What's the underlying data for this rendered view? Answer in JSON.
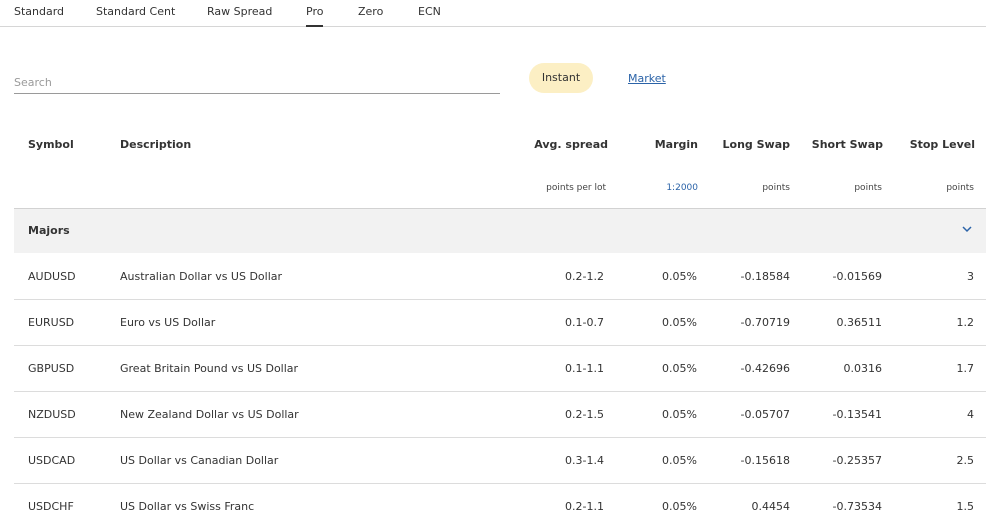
{
  "tabs": [
    {
      "label": "Standard"
    },
    {
      "label": "Standard Cent"
    },
    {
      "label": "Raw Spread"
    },
    {
      "label": "Pro",
      "active": true
    },
    {
      "label": "Zero"
    },
    {
      "label": "ECN"
    }
  ],
  "search": {
    "placeholder": "Search",
    "value": ""
  },
  "execution": {
    "instant": "Instant",
    "market": "Market",
    "selected": "Instant",
    "selected_color": "#fcefc4",
    "link_color": "#2b63a8"
  },
  "table": {
    "columns": {
      "symbol": "Symbol",
      "description": "Description",
      "spread": "Avg. spread",
      "margin": "Margin",
      "long_swap": "Long Swap",
      "short_swap": "Short Swap",
      "stop_level": "Stop Level"
    },
    "units": {
      "spread": "points per lot",
      "margin": "1:2000",
      "long_swap": "points",
      "short_swap": "points",
      "stop_level": "points"
    },
    "group": {
      "label": "Majors",
      "icon": "chevron-down-icon"
    },
    "rows": [
      {
        "symbol": "AUDUSD",
        "description": "Australian Dollar vs US Dollar",
        "spread": "0.2-1.2",
        "margin": "0.05%",
        "long_swap": "-0.18584",
        "short_swap": "-0.01569",
        "stop_level": "3"
      },
      {
        "symbol": "EURUSD",
        "description": "Euro vs US Dollar",
        "spread": "0.1-0.7",
        "margin": "0.05%",
        "long_swap": "-0.70719",
        "short_swap": "0.36511",
        "stop_level": "1.2"
      },
      {
        "symbol": "GBPUSD",
        "description": "Great Britain Pound vs US Dollar",
        "spread": "0.1-1.1",
        "margin": "0.05%",
        "long_swap": "-0.42696",
        "short_swap": "0.0316",
        "stop_level": "1.7"
      },
      {
        "symbol": "NZDUSD",
        "description": "New Zealand Dollar vs US Dollar",
        "spread": "0.2-1.5",
        "margin": "0.05%",
        "long_swap": "-0.05707",
        "short_swap": "-0.13541",
        "stop_level": "4"
      },
      {
        "symbol": "USDCAD",
        "description": "US Dollar vs Canadian Dollar",
        "spread": "0.3-1.4",
        "margin": "0.05%",
        "long_swap": "-0.15618",
        "short_swap": "-0.25357",
        "stop_level": "2.5"
      },
      {
        "symbol": "USDCHF",
        "description": "US Dollar vs Swiss Franc",
        "spread": "0.2-1.1",
        "margin": "0.05%",
        "long_swap": "0.4454",
        "short_swap": "-0.73534",
        "stop_level": "1.5"
      }
    ]
  }
}
